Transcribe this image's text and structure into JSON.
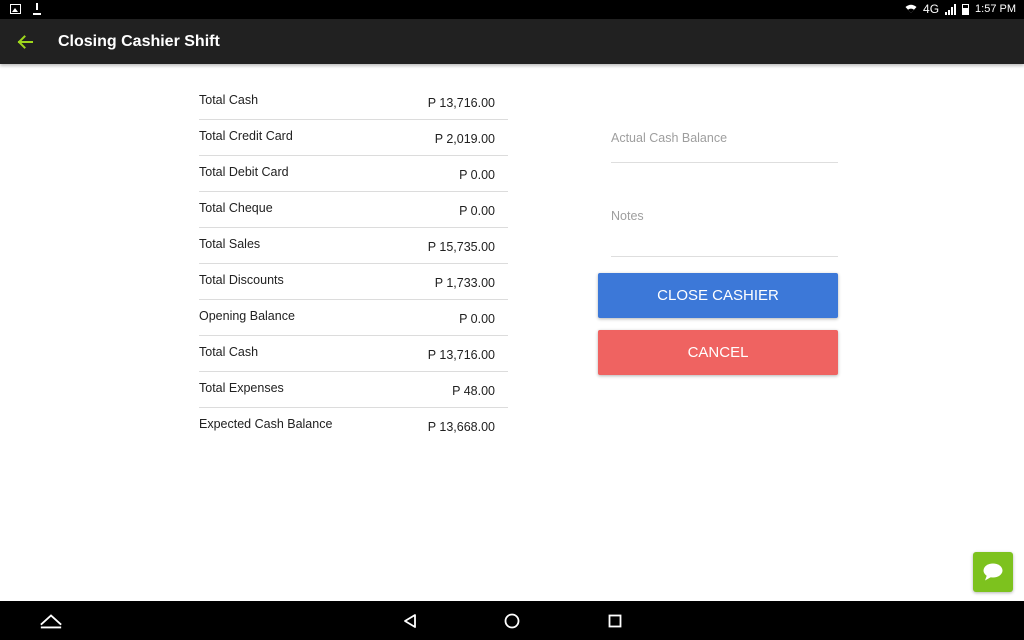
{
  "status_bar": {
    "network": "4G",
    "time": "1:57 PM",
    "icons": [
      "image-icon",
      "download-icon",
      "wifi-icon",
      "signal-icon",
      "battery-icon"
    ]
  },
  "app_bar": {
    "title": "Closing Cashier Shift",
    "back_icon": "arrow-left-icon",
    "accent_color": "#9ed71c"
  },
  "summary": [
    {
      "label": "Total Cash",
      "value": "P 13,716.00"
    },
    {
      "label": "Total Credit Card",
      "value": "P 2,019.00"
    },
    {
      "label": "Total Debit Card",
      "value": "P 0.00"
    },
    {
      "label": "Total Cheque",
      "value": "P 0.00"
    },
    {
      "label": "Total Sales",
      "value": "P 15,735.00"
    },
    {
      "label": "Total Discounts",
      "value": "P 1,733.00"
    },
    {
      "label": "Opening Balance",
      "value": "P 0.00"
    },
    {
      "label": "Total Cash",
      "value": "P 13,716.00"
    },
    {
      "label": "Total Expenses",
      "value": "P 48.00"
    },
    {
      "label": "Expected Cash Balance",
      "value": "P 13,668.00"
    }
  ],
  "form": {
    "actual_cash_placeholder": "Actual Cash Balance",
    "actual_cash_value": "",
    "notes_placeholder": "Notes",
    "notes_value": ""
  },
  "buttons": {
    "close_label": "CLOSE CASHIER",
    "close_color": "#3c78d8",
    "cancel_label": "CANCEL",
    "cancel_color": "#ef6361"
  },
  "chat_fab": {
    "icon": "chat-bubble-icon",
    "color": "#7dc21e"
  },
  "nav_bar": {
    "icons": [
      "chevron-up-icon",
      "nav-back-icon",
      "nav-home-icon",
      "nav-recent-icon"
    ]
  }
}
